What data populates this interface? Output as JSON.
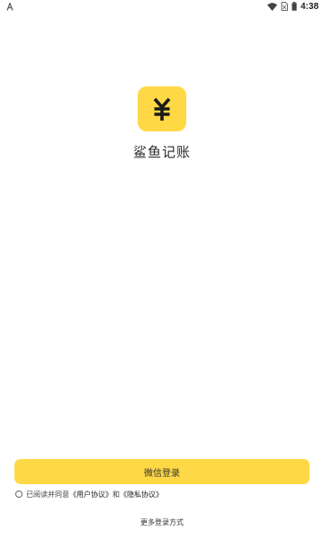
{
  "status_bar": {
    "left_icon": "a-notification-icon",
    "icons": [
      "wifi-icon",
      "no-sim-icon",
      "battery-icon"
    ],
    "time": "4:38"
  },
  "logo": {
    "icon": "yen-sign-icon",
    "symbol": "¥",
    "accent_color": "#FFD845"
  },
  "app_name": "鲨鱼记账",
  "login": {
    "wechat_button_label": "微信登录"
  },
  "agreement": {
    "checked": false,
    "prefix": "已阅读并同意",
    "user_agreement": "《用户协议》",
    "connector": "和",
    "privacy_policy": "《隐私协议》"
  },
  "more_login_label": "更多登录方式"
}
